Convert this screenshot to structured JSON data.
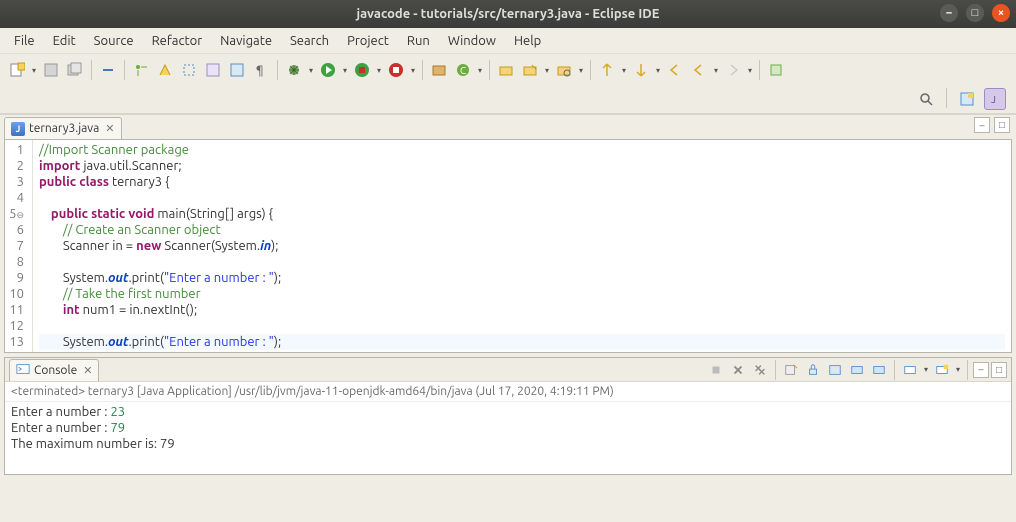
{
  "window": {
    "title": "javacode - tutorials/src/ternary3.java - Eclipse IDE"
  },
  "menu": {
    "file": "File",
    "edit": "Edit",
    "source": "Source",
    "refactor": "Refactor",
    "navigate": "Navigate",
    "search": "Search",
    "project": "Project",
    "run": "Run",
    "window": "Window",
    "help": "Help"
  },
  "editor": {
    "tab_label": "ternary3.java",
    "lines": [
      {
        "n": 1,
        "html": "<span class='cm'>//Import Scanner package</span>"
      },
      {
        "n": 2,
        "html": "<span class='kw'>import</span> java.util.Scanner;"
      },
      {
        "n": 3,
        "html": "<span class='kw'>public class</span> ternary3 {"
      },
      {
        "n": 4,
        "html": ""
      },
      {
        "n": 5,
        "html": "    <span class='kw'>public static void</span> main(String[] args) {"
      },
      {
        "n": 6,
        "html": "        <span class='cm'>// Create an Scanner object</span>"
      },
      {
        "n": 7,
        "html": "        Scanner in = <span class='kw'>new</span> Scanner(System.<span class='stat'>in</span>);"
      },
      {
        "n": 8,
        "html": ""
      },
      {
        "n": 9,
        "html": "        System.<span class='stat'>out</span>.print(<span class='str'>\"Enter a number : \"</span>);"
      },
      {
        "n": 10,
        "html": "        <span class='cm'>// Take the first number</span>"
      },
      {
        "n": 11,
        "html": "        <span class='kw'>int</span> num1 = in.nextInt();"
      },
      {
        "n": 12,
        "html": ""
      },
      {
        "n": 13,
        "html": "        System.<span class='stat'>out</span>.print(<span class='str'>\"Enter a number : \"</span>);"
      }
    ]
  },
  "console": {
    "tab_label": "Console",
    "status": "<terminated> ternary3 [Java Application] /usr/lib/jvm/java-11-openjdk-amd64/bin/java (Jul 17, 2020, 4:19:11 PM)",
    "output": [
      {
        "prefix": "Enter a number : ",
        "value": "23"
      },
      {
        "prefix": "Enter a number : ",
        "value": "79"
      },
      {
        "prefix": "The maximum number is: 79",
        "value": ""
      }
    ]
  }
}
